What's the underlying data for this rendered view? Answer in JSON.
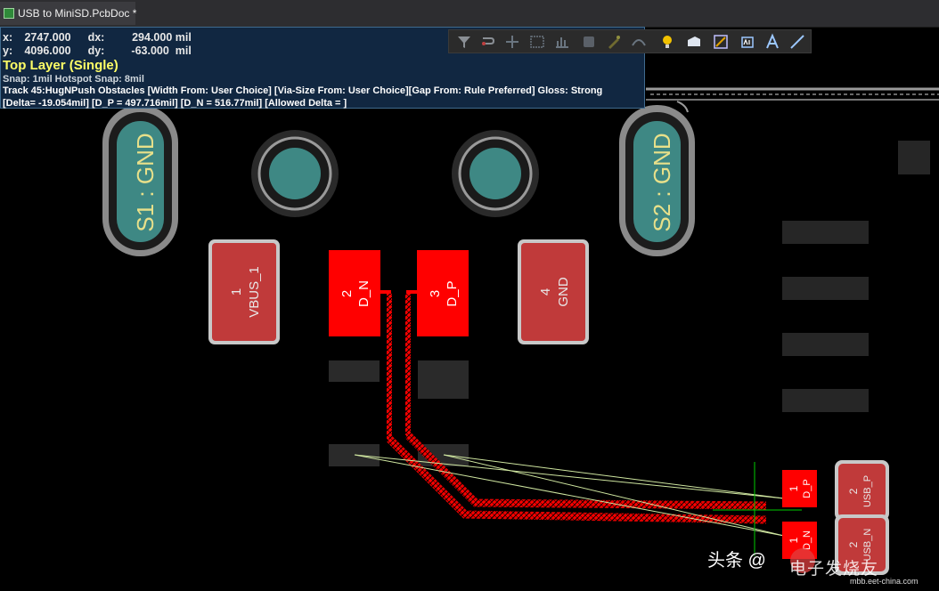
{
  "window": {
    "document_tab": "USB to MiniSD.PcbDoc *"
  },
  "hud": {
    "x_label": "x:",
    "x_value": "2747.000",
    "dx_label": "dx:",
    "dx_value": "294.000 mil",
    "y_label": "y:",
    "y_value": "4096.000",
    "dy_label": "dy:",
    "dy_value": "-63.000  mil",
    "layer": "Top Layer (Single)",
    "snap": "Snap: 1mil Hotspot Snap: 8mil",
    "mode": "Track 45:HugNPush Obstacles [Width From: User Choice]  [Via-Size From: User Choice][Gap From: Rule Preferred] Gloss: Strong",
    "delta": "[Delta= -19.054mil] [D_P = 497.716mil] [D_N = 516.77mil] [Allowed Delta = ]"
  },
  "toolbar": {
    "icons": [
      "filter-icon",
      "route-icon",
      "cross-icon",
      "select-rect-icon",
      "chart-icon",
      "component-icon",
      "pen-icon",
      "arc-icon",
      "bulb-icon",
      "fill-icon",
      "dimension-icon",
      "string-icon",
      "text-icon",
      "line-icon"
    ]
  },
  "pcb": {
    "pads": {
      "s1": "S1 : GND",
      "s2": "S2 : GND",
      "pad1_num": "1",
      "pad1_net": "VBUS_1",
      "pad2_num": "2",
      "pad2_net": "D_N",
      "pad3_num": "3",
      "pad3_net": "D_P",
      "pad4_num": "4",
      "pad4_net": "GND",
      "right_pad1_num": "1",
      "right_pad1_net": "D_P",
      "right_pad2_num": "1",
      "right_pad2_net": "D_N",
      "usb_p_num": "2",
      "usb_p_net": "USB_P",
      "usb_n_num": "2",
      "usb_n_net": "USB_N"
    },
    "colors": {
      "background": "#000000",
      "pad_red": "#ff0000",
      "pad_dim": "#c03030",
      "hole_teal": "#3a8a8a",
      "ratsnest": "#cfe6a0",
      "cursor": "#00ff00"
    }
  },
  "watermark": {
    "text": "头条 @",
    "site": "电子发烧友",
    "url": "mbb.eet-china.com"
  }
}
